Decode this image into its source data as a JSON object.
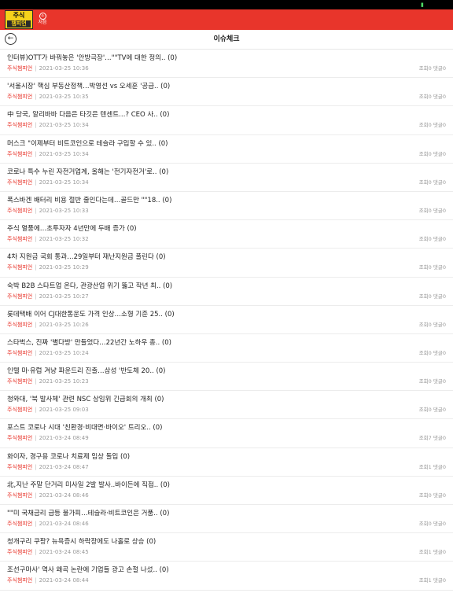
{
  "app": {
    "logo_line1": "주식",
    "logo_line2": "챔피언",
    "home_label": "처음",
    "page_title": "이슈체크"
  },
  "colors": {
    "accent": "#e8352b",
    "logo_bg": "#f6d21b"
  },
  "icons": {
    "back": "back-arrow-icon",
    "home": "home-icon"
  },
  "labels": {
    "views": "조회",
    "comments": "댓글"
  },
  "items": [
    {
      "title": "인터뷰)OTT가 바꿔놓은 '안방극장'…\"\"TV에 대한 정의..",
      "count": "(0)",
      "author": "주식챔피언",
      "date": "2021-03-25 10:36",
      "views": "0",
      "comments": "0"
    },
    {
      "title": "'서울시장' 핵심 부동산정책…박영선 vs 오세훈 '공급..",
      "count": "(0)",
      "author": "주식챔피언",
      "date": "2021-03-25 10:35",
      "views": "0",
      "comments": "0"
    },
    {
      "title": "中 당국, 알리바바 다음은 타깃은 텐센트…? CEO 사..",
      "count": "(0)",
      "author": "주식챔피언",
      "date": "2021-03-25 10:34",
      "views": "0",
      "comments": "0"
    },
    {
      "title": "머스크 \"이제부터 비트코인으로 테슬라 구입할 수 있..",
      "count": "(0)",
      "author": "주식챔피언",
      "date": "2021-03-25 10:34",
      "views": "0",
      "comments": "0"
    },
    {
      "title": "코로나 특수 누린 자전거업계, 올해는 '전기자전거'로..",
      "count": "(0)",
      "author": "주식챔피언",
      "date": "2021-03-25 10:34",
      "views": "0",
      "comments": "0"
    },
    {
      "title": "폭스바겐 배터리 비용 절반 줄인다는데…골드만 \"\"18..",
      "count": "(0)",
      "author": "주식챔피언",
      "date": "2021-03-25 10:33",
      "views": "0",
      "comments": "0"
    },
    {
      "title": "주식 열풍에…초투자자 4년만에 두배 증가",
      "count": "(0)",
      "author": "주식챔피언",
      "date": "2021-03-25 10:32",
      "views": "0",
      "comments": "0"
    },
    {
      "title": "4차 지원금 국회 통과…29일부터 재난지원금 풀린다",
      "count": "(0)",
      "author": "주식챔피언",
      "date": "2021-03-25 10:29",
      "views": "0",
      "comments": "0"
    },
    {
      "title": "숙박 B2B 스타트업 온다, 관광산업 위기 뚫고 작년 최..",
      "count": "(0)",
      "author": "주식챔피언",
      "date": "2021-03-25 10:27",
      "views": "0",
      "comments": "0"
    },
    {
      "title": "롯데택배 이어 CJ대한통운도 가격 인상…소형 기준 25..",
      "count": "(0)",
      "author": "주식챔피언",
      "date": "2021-03-25 10:26",
      "views": "0",
      "comments": "0"
    },
    {
      "title": "스타벅스, 진짜 '별다방' 만들었다…22년간 노하우 총..",
      "count": "(0)",
      "author": "주식챔피언",
      "date": "2021-03-25 10:24",
      "views": "0",
      "comments": "0"
    },
    {
      "title": "인텔 마·유럽 겨냥 파운드리 진출…삼성 '반도체 20..",
      "count": "(0)",
      "author": "주식챔피언",
      "date": "2021-03-25 10:23",
      "views": "0",
      "comments": "0"
    },
    {
      "title": "청와대, '북 발사체' 관련 NSC 상임위 긴급회의 개최",
      "count": "(0)",
      "author": "주식챔피언",
      "date": "2021-03-25 09:03",
      "views": "0",
      "comments": "0"
    },
    {
      "title": "포스트 코로나 시대 '친환경·비대면·바이오' 트리오..",
      "count": "(0)",
      "author": "주식챔피언",
      "date": "2021-03-24 08:49",
      "views": "7",
      "comments": "0"
    },
    {
      "title": "화이자, 경구용 코로나 치료제 임상 돌입",
      "count": "(0)",
      "author": "주식챔피언",
      "date": "2021-03-24 08:47",
      "views": "1",
      "comments": "0"
    },
    {
      "title": "北,지난 주말 단거리 미사일 2발 발사..바이든에 직접..",
      "count": "(0)",
      "author": "주식챔피언",
      "date": "2021-03-24 08:46",
      "views": "0",
      "comments": "0"
    },
    {
      "title": "\"\"미 국채금리 급등 불가피…테슬라·비트코인은 거품..",
      "count": "(0)",
      "author": "주식챔피언",
      "date": "2021-03-24 08:46",
      "views": "0",
      "comments": "0"
    },
    {
      "title": "청개구리 쿠팡? 뉴욕증시 하락장에도 나홀로 상승",
      "count": "(0)",
      "author": "주식챔피언",
      "date": "2021-03-24 08:45",
      "views": "1",
      "comments": "0"
    },
    {
      "title": "조선구마사' 역사 왜곡 논란에 기업들 광고 손절 나섰..",
      "count": "(0)",
      "author": "주식챔피언",
      "date": "2021-03-24 08:44",
      "views": "1",
      "comments": "0"
    }
  ]
}
